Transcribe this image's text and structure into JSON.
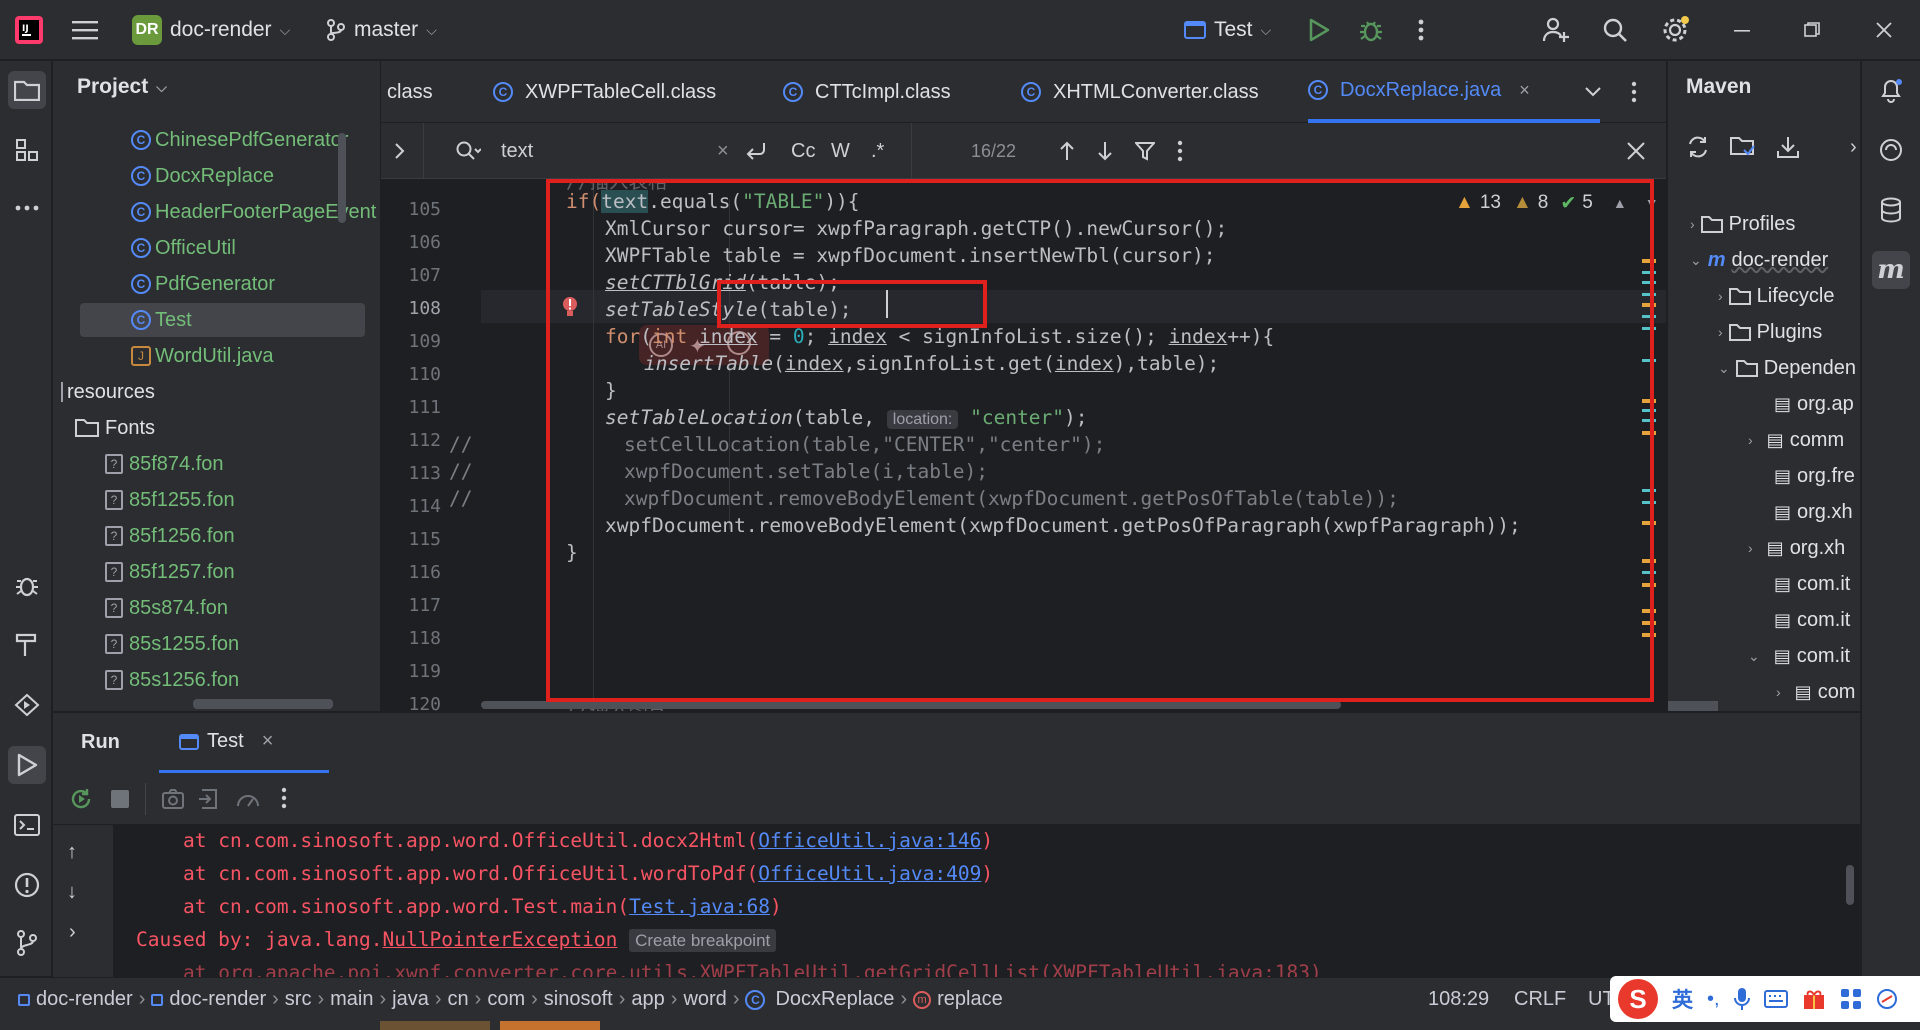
{
  "titlebar": {
    "project_badge": "DR",
    "project_name": "doc-render",
    "branch": "master",
    "run_config": "Test"
  },
  "project_panel": {
    "title": "Project",
    "items": [
      {
        "label": "ChinesePdfGenerator",
        "kind": "class"
      },
      {
        "label": "DocxReplace",
        "kind": "class"
      },
      {
        "label": "HeaderFooterPageEvent",
        "kind": "class"
      },
      {
        "label": "OfficeUtil",
        "kind": "class"
      },
      {
        "label": "PdfGenerator",
        "kind": "class"
      },
      {
        "label": "Test",
        "kind": "class"
      },
      {
        "label": "WordUtil.java",
        "kind": "java"
      },
      {
        "label": "resources",
        "kind": "folder"
      },
      {
        "label": "Fonts",
        "kind": "folder"
      },
      {
        "label": "85f874.fon",
        "kind": "file"
      },
      {
        "label": "85f1255.fon",
        "kind": "file"
      },
      {
        "label": "85f1256.fon",
        "kind": "file"
      },
      {
        "label": "85f1257.fon",
        "kind": "file"
      },
      {
        "label": "85s874.fon",
        "kind": "file"
      },
      {
        "label": "85s1255.fon",
        "kind": "file"
      },
      {
        "label": "85s1256.fon",
        "kind": "file"
      }
    ]
  },
  "editor_tabs": [
    {
      "label": "class"
    },
    {
      "label": "XWPFTableCell.class"
    },
    {
      "label": "CTTcImpl.class"
    },
    {
      "label": "XHTMLConverter.class"
    },
    {
      "label": "DocxReplace.java"
    }
  ],
  "find": {
    "query": "text",
    "case_label": "Cc",
    "word_label": "W",
    "regex_label": ".*",
    "match_count": "16/22"
  },
  "inspections": {
    "warnings": "13",
    "weak_warnings": "8",
    "ok": "5"
  },
  "gutter": {
    "lines": [
      "105",
      "106",
      "107",
      "108",
      "109",
      "110",
      "111",
      "112",
      "113",
      "114",
      "115",
      "116",
      "117",
      "118",
      "119",
      "120"
    ]
  },
  "code": {
    "l105_if": "if(",
    "l105_text": "text",
    "l105_rest": ".equals(",
    "l105_str": "\"TABLE\"",
    "l105_end": ")){",
    "l106": "XmlCursor cursor= xwpfParagraph.getCTP().newCursor();",
    "l107": "XWPFTable table = xwpfDocument.insertNewTbl(cursor);",
    "l108_m": "setCTTblGrid",
    "l108_rest": "(table);",
    "l109_m": "setTableStyle",
    "l109_rest": "(table);",
    "l110_kw": "for",
    "l110_a": "(",
    "l110_int": "int",
    "l110_b": " ",
    "l110_idx1": "index",
    "l110_c": " = ",
    "l110_zero": "0",
    "l110_d": "; ",
    "l110_idx2": "index",
    "l110_e": " < signInfoList.size(); ",
    "l110_idx3": "index",
    "l110_f": "++){",
    "l111_m": "insertTable",
    "l111_a": "(",
    "l111_idx1": "index",
    "l111_b": ",signInfoList.get(",
    "l111_idx2": "index",
    "l111_c": "),table);",
    "l112": "}",
    "l113_m": "setTableLocation",
    "l113_a": "(table, ",
    "l113_hint": "location:",
    "l113_str": "\"center\"",
    "l113_end": ");",
    "l114_cmt": "//",
    "l114": "setCellLocation(table,\"CENTER\",\"center\");",
    "l115_cmt": "//",
    "l115": "xwpfDocument.setTable(i,table);",
    "l116_cmt": "//",
    "l116": "xwpfDocument.removeBodyElement(xwpfDocument.getPosOfTable(table));",
    "l117": "xwpfDocument.removeBodyElement(xwpfDocument.getPosOfParagraph(xwpfParagraph));",
    "l118": "}"
  },
  "maven": {
    "title": "Maven",
    "items": [
      {
        "label": "Profiles"
      },
      {
        "label": "doc-render"
      },
      {
        "label": "Lifecycle"
      },
      {
        "label": "Plugins"
      },
      {
        "label": "Dependen"
      },
      {
        "label": "org.ap"
      },
      {
        "label": "comm"
      },
      {
        "label": "org.fre"
      },
      {
        "label": "org.xh"
      },
      {
        "label": "org.xh"
      },
      {
        "label": "com.it"
      },
      {
        "label": "com.it"
      },
      {
        "label": "com.it"
      },
      {
        "label": "com"
      },
      {
        "label": "com"
      }
    ]
  },
  "run": {
    "tab_run": "Run",
    "tab_test": "Test",
    "lines": [
      {
        "prefix": "at cn.com.sinosoft.app.word.OfficeUtil.docx2Html(",
        "link": "OfficeUtil.java:146",
        "suffix": ")"
      },
      {
        "prefix": "at cn.com.sinosoft.app.word.OfficeUtil.wordToPdf(",
        "link": "OfficeUtil.java:409",
        "suffix": ")"
      },
      {
        "prefix": "at cn.com.sinosoft.app.word.Test.main(",
        "link": "Test.java:68",
        "suffix": ")"
      }
    ],
    "caused_by": "Caused by: java.lang.",
    "exception": "NullPointerException",
    "breakpoint_hint": "Create breakpoint"
  },
  "statusbar": {
    "crumbs": [
      "doc-render",
      "doc-render",
      "src",
      "main",
      "java",
      "cn",
      "com",
      "sinosoft",
      "app",
      "word",
      "DocxReplace",
      "replace"
    ],
    "position": "108:29",
    "line_sep": "CRLF",
    "encoding": "UT"
  },
  "ime": {
    "lang": "英"
  },
  "colors": {
    "accent": "#3574f0",
    "highlight_box": "#e0201c",
    "error": "#f75464"
  }
}
